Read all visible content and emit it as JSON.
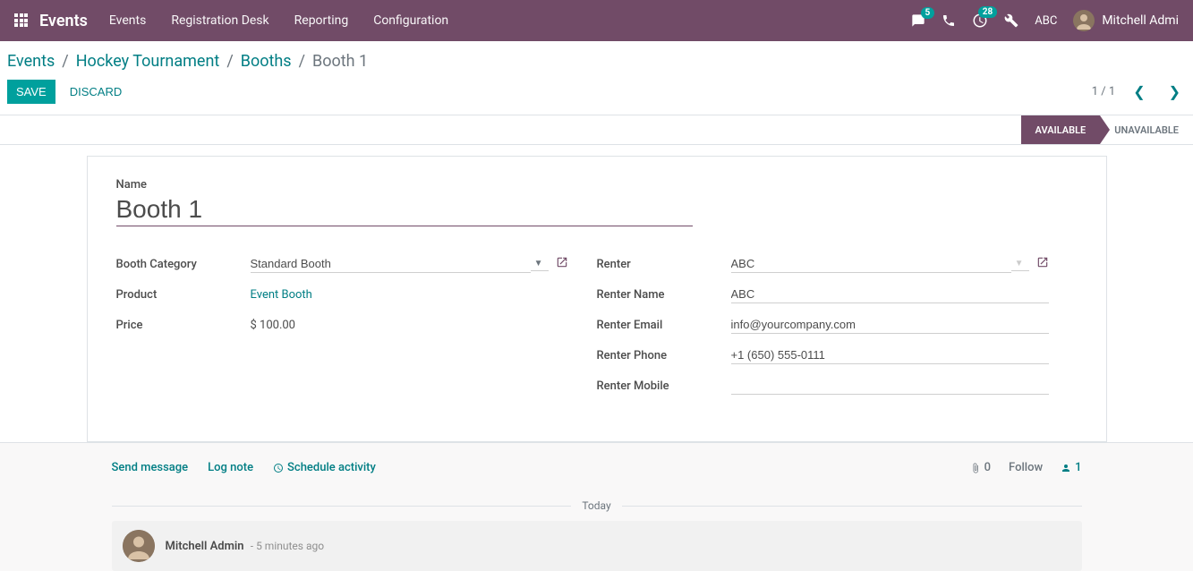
{
  "nav": {
    "brand": "Events",
    "menu": [
      "Events",
      "Registration Desk",
      "Reporting",
      "Configuration"
    ],
    "messages_badge": "5",
    "activities_badge": "28",
    "company": "ABC",
    "user": "Mitchell Admi"
  },
  "breadcrumb": {
    "items": [
      "Events",
      "Hockey Tournament",
      "Booths"
    ],
    "current": "Booth 1"
  },
  "buttons": {
    "save": "SAVE",
    "discard": "DISCARD"
  },
  "pager": {
    "text": "1 / 1"
  },
  "statusbar": {
    "available": "AVAILABLE",
    "unavailable": "UNAVAILABLE"
  },
  "form": {
    "name_label": "Name",
    "name_value": "Booth 1",
    "left": {
      "booth_category_label": "Booth Category",
      "booth_category_value": "Standard Booth",
      "product_label": "Product",
      "product_value": "Event Booth",
      "price_label": "Price",
      "price_value": "$ 100.00"
    },
    "right": {
      "renter_label": "Renter",
      "renter_value": "ABC",
      "renter_name_label": "Renter Name",
      "renter_name_value": "ABC",
      "renter_email_label": "Renter Email",
      "renter_email_value": "info@yourcompany.com",
      "renter_phone_label": "Renter Phone",
      "renter_phone_value": "+1 (650) 555-0111",
      "renter_mobile_label": "Renter Mobile",
      "renter_mobile_value": ""
    }
  },
  "chatter": {
    "send_message": "Send message",
    "log_note": "Log note",
    "schedule_activity": "Schedule activity",
    "attachments": "0",
    "follow": "Follow",
    "followers": "1",
    "today": "Today",
    "msg_author": "Mitchell Admin",
    "msg_time": "- 5 minutes ago"
  }
}
